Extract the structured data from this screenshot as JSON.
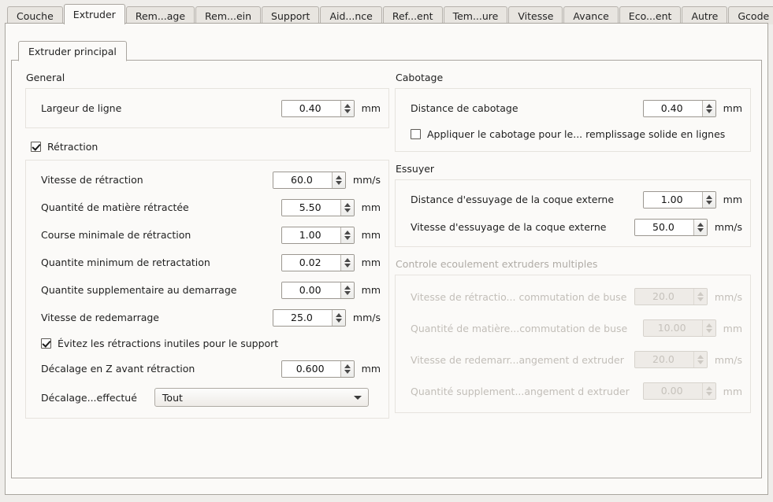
{
  "tabs": [
    {
      "label": "Couche",
      "selected": false
    },
    {
      "label": "Extruder",
      "selected": true
    },
    {
      "label": "Rem...age",
      "selected": false
    },
    {
      "label": "Rem...ein",
      "selected": false
    },
    {
      "label": "Support",
      "selected": false
    },
    {
      "label": "Aid...nce",
      "selected": false
    },
    {
      "label": "Ref...ent",
      "selected": false
    },
    {
      "label": "Tem...ure",
      "selected": false
    },
    {
      "label": "Vitesse",
      "selected": false
    },
    {
      "label": "Avance",
      "selected": false
    },
    {
      "label": "Eco...ent",
      "selected": false
    },
    {
      "label": "Autre",
      "selected": false
    },
    {
      "label": "Gcode",
      "selected": false
    }
  ],
  "inner_tab": {
    "label": "Extruder principal"
  },
  "left": {
    "general": {
      "title": "General",
      "rows": [
        {
          "label": "Largeur de ligne",
          "value": "0.40",
          "unit": "mm"
        }
      ]
    },
    "retraction": {
      "checkbox": {
        "label": "Rétraction",
        "checked": true
      },
      "rows": [
        {
          "label": "Vitesse de rétraction",
          "value": "60.0",
          "unit": "mm/s"
        },
        {
          "label": "Quantité de matière rétractée",
          "value": "5.50",
          "unit": "mm"
        },
        {
          "label": "Course minimale de rétraction",
          "value": "1.00",
          "unit": "mm"
        },
        {
          "label": "Quantite minimum de retractation",
          "value": "0.02",
          "unit": "mm"
        },
        {
          "label": "Quantite supplementaire au demarrage",
          "value": "0.00",
          "unit": "mm"
        },
        {
          "label": "Vitesse de redemarrage",
          "value": "25.0",
          "unit": "mm/s"
        }
      ],
      "avoid_checkbox": {
        "label": "Évitez les rétractions inutiles pour le support",
        "checked": true
      },
      "zhop_row": {
        "label": "Décalage en Z avant rétraction",
        "value": "0.600",
        "unit": "mm"
      },
      "combo_row": {
        "label": "Décalage...effectué",
        "value": "Tout"
      }
    }
  },
  "right": {
    "cabotage": {
      "title": "Cabotage",
      "rows": [
        {
          "label": "Distance de cabotage",
          "value": "0.40",
          "unit": "mm"
        }
      ],
      "checkbox": {
        "label": "Appliquer le cabotage pour le... remplissage solide en lignes",
        "checked": false
      }
    },
    "essuyer": {
      "title": "Essuyer",
      "rows": [
        {
          "label": "Distance d'essuyage de la coque externe",
          "value": "1.00",
          "unit": "mm"
        },
        {
          "label": "Vitesse d'essuyage de la coque externe",
          "value": "50.0",
          "unit": "mm/s"
        }
      ]
    },
    "flow": {
      "title": "Controle ecoulement extruders multiples",
      "disabled": true,
      "rows": [
        {
          "label": "Vitesse de rétractio... commutation de buse",
          "value": "20.0",
          "unit": "mm/s"
        },
        {
          "label": "Quantité de matière...commutation de buse",
          "value": "10.00",
          "unit": "mm"
        },
        {
          "label": "Vitesse de redemarr...angement d extruder",
          "value": "20.0",
          "unit": "mm/s"
        },
        {
          "label": "Quantité supplement...angement d extruder",
          "value": "0.00",
          "unit": "mm"
        }
      ]
    }
  }
}
